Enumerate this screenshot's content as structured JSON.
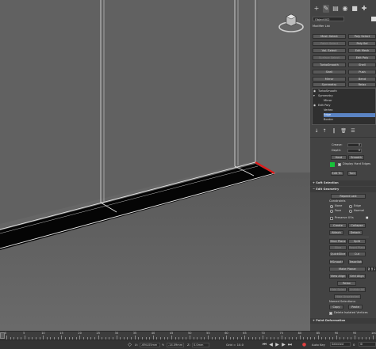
{
  "panel": {
    "tabs": [
      "+",
      "modify",
      "hierarchy",
      "motion",
      "display",
      "utilities"
    ],
    "object_name": "Object002",
    "modifier_list_label": "Modifier List",
    "modifier_buttons": [
      [
        "Mesh Select",
        "Poly Select"
      ],
      [
        "Patch Select",
        "Poly Sel"
      ],
      [
        "Vol. Select",
        "Edit Mesh"
      ],
      [
        "Surface Select",
        "Edit Poly"
      ],
      [
        "TurboSmooth",
        "Shell"
      ],
      [
        "Shell",
        "Push"
      ],
      [
        "Mirror",
        "Bend"
      ],
      [
        "Symmetry",
        "Relax"
      ]
    ],
    "stack": [
      "TurboSmooth",
      "Symmetry",
      "Mirror",
      "Edit Poly",
      "Vertex",
      "Edge",
      "Border"
    ],
    "stack_selected": "Edge",
    "crease_label": "Crease:",
    "crease_value": "0",
    "depth_label": "Depth:",
    "depth_value": "0",
    "hard_button": "Hard",
    "smooth_button": "Smooth",
    "display_hard_edges_label": "Display Hard Edges",
    "edit_tri_button": "Edit Tri.",
    "turn_button": "Turn",
    "soft_selection_title": "Soft Selection",
    "edit_geometry_title": "Edit Geometry",
    "repeat_last": "Repeat Last",
    "constraints_label": "Constraints",
    "constraints": [
      "None",
      "Edge",
      "Face",
      "Normal"
    ],
    "preserve_uvs": "Preserve UVs",
    "create": "Create",
    "collapse": "Collapse",
    "attach": "Attach",
    "detach": "Detach",
    "slice_plane": "Slice Plane",
    "split": "Split",
    "slice": "Slice",
    "reset_plane": "Reset Plane",
    "quickslice": "QuickSlice",
    "cut": "Cut",
    "msmooth": "MSmooth",
    "tessellate": "Tessellate",
    "make_planar": "Make Planar",
    "x": "X",
    "y": "Y",
    "z": "Z",
    "view_align": "View Align",
    "grid_align": "Grid Align",
    "relax": "Relax",
    "hide_selected": "Hide Selected",
    "unhide_all": "Unhide All",
    "hide_unselected": "Hide Unselected",
    "named_selections": "Named Selections:",
    "copy": "Copy",
    "paste": "Paste",
    "delete_isolated": "Delete Isolated Vertices",
    "paint_deformation": "Paint Deformation"
  },
  "timeline": {
    "ticks": [
      "0",
      "5",
      "10",
      "15",
      "20",
      "25",
      "30",
      "35",
      "40",
      "45",
      "50",
      "55",
      "60",
      "65",
      "70",
      "75",
      "80",
      "85",
      "90",
      "95",
      "100"
    ]
  },
  "status": {
    "x_label": "X:",
    "x_value": "-694.05mm",
    "y_label": "Y:",
    "y_value": "-14.09mm",
    "z_label": "Z:",
    "z_value": "0.0mm",
    "grid": "Grid = 10.0",
    "auto_key": "Auto Key",
    "selected": "Selected",
    "set_key": "Set Key",
    "key_filters": "Key Filters...",
    "frame": "0"
  },
  "colors": {
    "viewport_bg": "#666666",
    "edge_highlight": "#e01a1a",
    "selection_blue": "#5b84c4",
    "panel_bg": "#434343"
  }
}
